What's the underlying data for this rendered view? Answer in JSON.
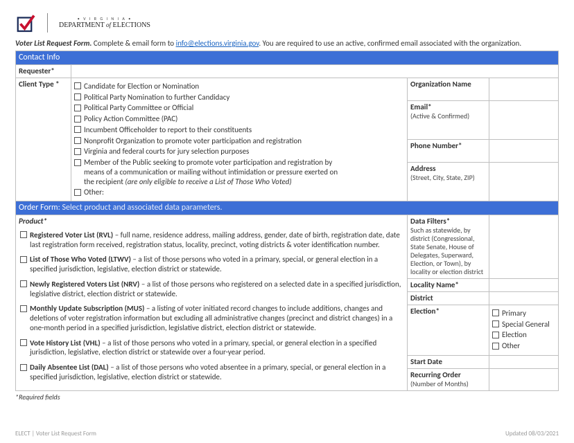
{
  "header": {
    "virginia": "• V I R G I N I A •",
    "dept_a": "DEPARTMENT",
    "dept_of": "of",
    "dept_b": "ELECTIONS"
  },
  "intro": {
    "title": "Voter List Request Form.",
    "pre": " Complete & email form to ",
    "email": "info@elections.virginia.gov",
    "post": ". You are required to use an active, confirmed email associated with the organization."
  },
  "bands": {
    "contact": "Contact Info",
    "order": "Order Form:",
    "order_sub": " Select product and associated data parameters."
  },
  "labels": {
    "requester": "Requester*",
    "client_type": "Client Type *",
    "org_name": "Organization Name",
    "email": "Email*",
    "email_sub": "(Active & Confirmed)",
    "phone": "Phone Number*",
    "address": "Address",
    "address_sub": "(Street, City, State, ZIP)",
    "product": "Product*",
    "data_filters": "Data Filters*",
    "data_filters_sub": "Such as statewide, by district (Congressional, State Senate, House of Delegates, Superward, Election, or Town), by locality or election district",
    "locality": "Locality Name*",
    "district": "District",
    "election": "Election*",
    "start_date": "Start Date",
    "recurring": "Recurring Order",
    "recurring_sub": "(Number of Months)"
  },
  "client_types": [
    "Candidate for Election or Nomination",
    "Political Party Nomination to further Candidacy",
    "Political Party Committee or Official",
    "Policy Action Committee (PAC)",
    "Incumbent Officeholder to report to their constituents",
    "Nonprofit Organization to promote voter participation and registration",
    "Virginia and federal courts for jury selection purposes"
  ],
  "client_type_member": {
    "line1": "Member of the Public seeking to promote voter participation and registration by",
    "line2": "means of a communication or mailing without intimidation or pressure exerted on",
    "line3_a": "the recipient ",
    "line3_b": "(are only eligible to receive a List of Those Who Voted)"
  },
  "client_type_other": "Other:",
  "products": [
    {
      "name": "Registered Voter List (RVL)",
      "desc": " – full name, residence address, mailing address, gender, date of birth, registration date, date last registration form received, registration status, locality, precinct, voting districts & voter identification number."
    },
    {
      "name": "List of Those Who Voted (LTWV)",
      "desc": " – a list of those persons who voted in a primary, special, or general election in a specified jurisdiction, legislative, election district or statewide."
    },
    {
      "name": "Newly Registered Voters List (NRV)",
      "desc": " – a list of those persons who registered on a selected date in a specified jurisdiction, legislative district, election district or statewide."
    },
    {
      "name": "Monthly Update Subscription (MUS)",
      "desc": " – a listing of voter initiated record changes to include additions, changes and deletions of voter registration information but excluding all administrative changes (precinct and district changes) in a one-month period in a specified jurisdiction, legislative district, election district or statewide."
    },
    {
      "name": "Vote History List (VHL)",
      "desc": " – a list of those persons who voted in a primary, special, or general election in a specified jurisdiction, legislative, election district or statewide over a four-year period."
    },
    {
      "name": "Daily Absentee List (DAL)",
      "desc": " – a list of those persons who voted absentee in a primary, special, or general election in a specified jurisdiction, legislative, election district or statewide."
    }
  ],
  "election_types": [
    "Primary",
    "Special  General",
    "Election",
    "Other"
  ],
  "required_note": "*Required fields",
  "footer": {
    "left": "ELECT | Voter List Request Form",
    "right": "Updated 08/03/2021"
  }
}
